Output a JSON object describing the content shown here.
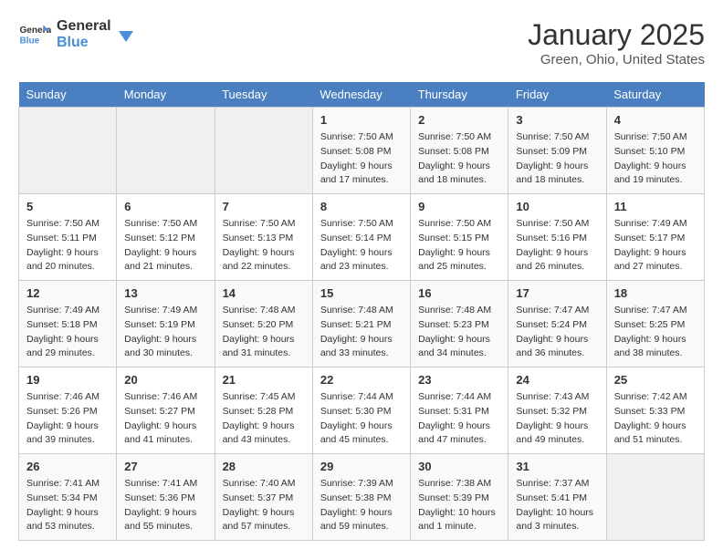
{
  "logo": {
    "line1": "General",
    "line2": "Blue"
  },
  "title": "January 2025",
  "subtitle": "Green, Ohio, United States",
  "weekdays": [
    "Sunday",
    "Monday",
    "Tuesday",
    "Wednesday",
    "Thursday",
    "Friday",
    "Saturday"
  ],
  "weeks": [
    [
      {
        "day": "",
        "info": ""
      },
      {
        "day": "",
        "info": ""
      },
      {
        "day": "",
        "info": ""
      },
      {
        "day": "1",
        "info": "Sunrise: 7:50 AM\nSunset: 5:08 PM\nDaylight: 9 hours\nand 17 minutes."
      },
      {
        "day": "2",
        "info": "Sunrise: 7:50 AM\nSunset: 5:08 PM\nDaylight: 9 hours\nand 18 minutes."
      },
      {
        "day": "3",
        "info": "Sunrise: 7:50 AM\nSunset: 5:09 PM\nDaylight: 9 hours\nand 18 minutes."
      },
      {
        "day": "4",
        "info": "Sunrise: 7:50 AM\nSunset: 5:10 PM\nDaylight: 9 hours\nand 19 minutes."
      }
    ],
    [
      {
        "day": "5",
        "info": "Sunrise: 7:50 AM\nSunset: 5:11 PM\nDaylight: 9 hours\nand 20 minutes."
      },
      {
        "day": "6",
        "info": "Sunrise: 7:50 AM\nSunset: 5:12 PM\nDaylight: 9 hours\nand 21 minutes."
      },
      {
        "day": "7",
        "info": "Sunrise: 7:50 AM\nSunset: 5:13 PM\nDaylight: 9 hours\nand 22 minutes."
      },
      {
        "day": "8",
        "info": "Sunrise: 7:50 AM\nSunset: 5:14 PM\nDaylight: 9 hours\nand 23 minutes."
      },
      {
        "day": "9",
        "info": "Sunrise: 7:50 AM\nSunset: 5:15 PM\nDaylight: 9 hours\nand 25 minutes."
      },
      {
        "day": "10",
        "info": "Sunrise: 7:50 AM\nSunset: 5:16 PM\nDaylight: 9 hours\nand 26 minutes."
      },
      {
        "day": "11",
        "info": "Sunrise: 7:49 AM\nSunset: 5:17 PM\nDaylight: 9 hours\nand 27 minutes."
      }
    ],
    [
      {
        "day": "12",
        "info": "Sunrise: 7:49 AM\nSunset: 5:18 PM\nDaylight: 9 hours\nand 29 minutes."
      },
      {
        "day": "13",
        "info": "Sunrise: 7:49 AM\nSunset: 5:19 PM\nDaylight: 9 hours\nand 30 minutes."
      },
      {
        "day": "14",
        "info": "Sunrise: 7:48 AM\nSunset: 5:20 PM\nDaylight: 9 hours\nand 31 minutes."
      },
      {
        "day": "15",
        "info": "Sunrise: 7:48 AM\nSunset: 5:21 PM\nDaylight: 9 hours\nand 33 minutes."
      },
      {
        "day": "16",
        "info": "Sunrise: 7:48 AM\nSunset: 5:23 PM\nDaylight: 9 hours\nand 34 minutes."
      },
      {
        "day": "17",
        "info": "Sunrise: 7:47 AM\nSunset: 5:24 PM\nDaylight: 9 hours\nand 36 minutes."
      },
      {
        "day": "18",
        "info": "Sunrise: 7:47 AM\nSunset: 5:25 PM\nDaylight: 9 hours\nand 38 minutes."
      }
    ],
    [
      {
        "day": "19",
        "info": "Sunrise: 7:46 AM\nSunset: 5:26 PM\nDaylight: 9 hours\nand 39 minutes."
      },
      {
        "day": "20",
        "info": "Sunrise: 7:46 AM\nSunset: 5:27 PM\nDaylight: 9 hours\nand 41 minutes."
      },
      {
        "day": "21",
        "info": "Sunrise: 7:45 AM\nSunset: 5:28 PM\nDaylight: 9 hours\nand 43 minutes."
      },
      {
        "day": "22",
        "info": "Sunrise: 7:44 AM\nSunset: 5:30 PM\nDaylight: 9 hours\nand 45 minutes."
      },
      {
        "day": "23",
        "info": "Sunrise: 7:44 AM\nSunset: 5:31 PM\nDaylight: 9 hours\nand 47 minutes."
      },
      {
        "day": "24",
        "info": "Sunrise: 7:43 AM\nSunset: 5:32 PM\nDaylight: 9 hours\nand 49 minutes."
      },
      {
        "day": "25",
        "info": "Sunrise: 7:42 AM\nSunset: 5:33 PM\nDaylight: 9 hours\nand 51 minutes."
      }
    ],
    [
      {
        "day": "26",
        "info": "Sunrise: 7:41 AM\nSunset: 5:34 PM\nDaylight: 9 hours\nand 53 minutes."
      },
      {
        "day": "27",
        "info": "Sunrise: 7:41 AM\nSunset: 5:36 PM\nDaylight: 9 hours\nand 55 minutes."
      },
      {
        "day": "28",
        "info": "Sunrise: 7:40 AM\nSunset: 5:37 PM\nDaylight: 9 hours\nand 57 minutes."
      },
      {
        "day": "29",
        "info": "Sunrise: 7:39 AM\nSunset: 5:38 PM\nDaylight: 9 hours\nand 59 minutes."
      },
      {
        "day": "30",
        "info": "Sunrise: 7:38 AM\nSunset: 5:39 PM\nDaylight: 10 hours\nand 1 minute."
      },
      {
        "day": "31",
        "info": "Sunrise: 7:37 AM\nSunset: 5:41 PM\nDaylight: 10 hours\nand 3 minutes."
      },
      {
        "day": "",
        "info": ""
      }
    ]
  ]
}
